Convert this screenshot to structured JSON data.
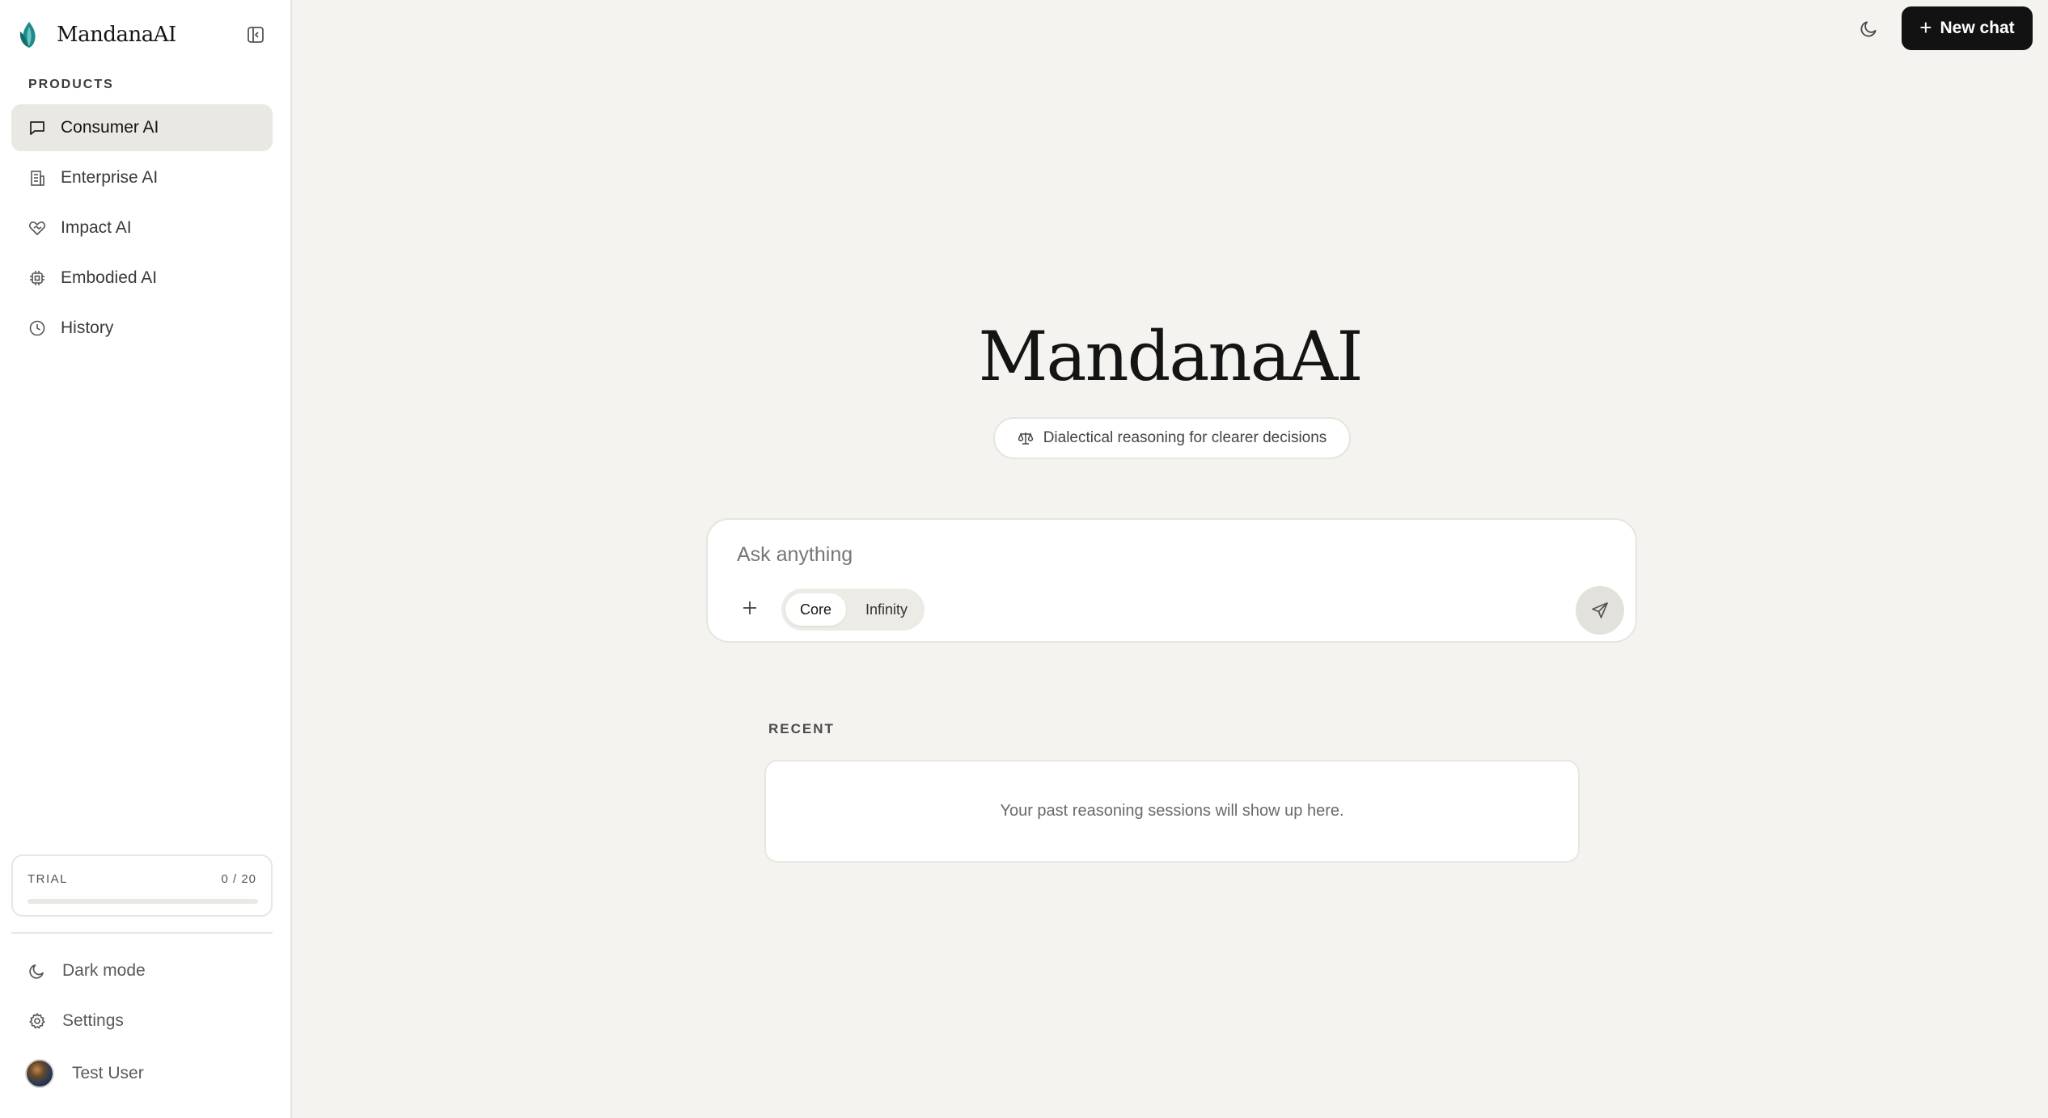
{
  "app": {
    "name": "MandanaAI"
  },
  "sidebar": {
    "section_label": "PRODUCTS",
    "items": [
      {
        "label": "Consumer AI",
        "icon": "chat-bubble-icon",
        "active": true
      },
      {
        "label": "Enterprise AI",
        "icon": "building-icon",
        "active": false
      },
      {
        "label": "Impact AI",
        "icon": "heart-handshake-icon",
        "active": false
      },
      {
        "label": "Embodied AI",
        "icon": "cpu-chip-icon",
        "active": false
      },
      {
        "label": "History",
        "icon": "clock-icon",
        "active": false
      }
    ],
    "trial": {
      "label": "TRIAL",
      "count": "0 / 20",
      "used": 0,
      "total": 20
    },
    "dark_mode_label": "Dark mode",
    "settings_label": "Settings",
    "user_name": "Test User"
  },
  "header": {
    "new_chat_label": "New chat"
  },
  "hero": {
    "title": "MandanaAI",
    "tagline": "Dialectical reasoning for clearer decisions"
  },
  "composer": {
    "placeholder": "Ask anything",
    "modes": [
      "Core",
      "Infinity"
    ],
    "selected_mode": "Core"
  },
  "recent": {
    "label": "RECENT",
    "empty_text": "Your past reasoning sessions will show up here."
  },
  "colors": {
    "background": "#f4f3ef",
    "sidebar": "#ffffff",
    "accent_logo": "#1f8a8a",
    "primary_button": "#121212"
  }
}
